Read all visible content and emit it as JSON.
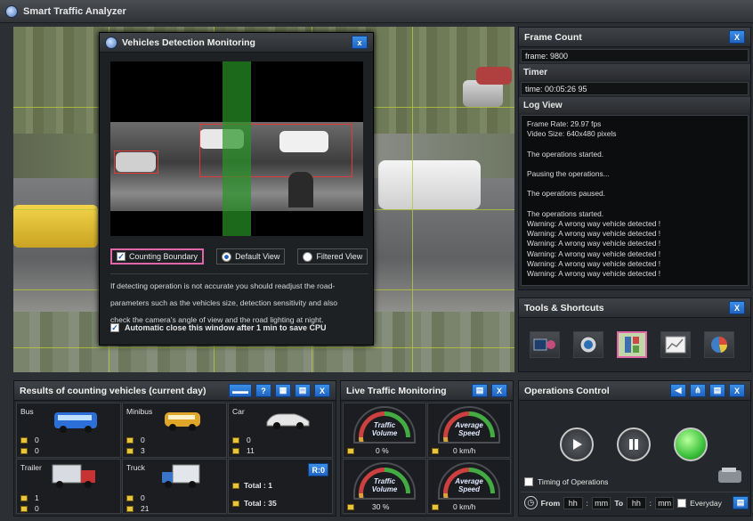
{
  "app": {
    "title": "Smart Traffic Analyzer"
  },
  "dialog": {
    "title": "Vehicles Detection Monitoring",
    "close_label": "x",
    "counting_boundary": "Counting Boundary",
    "default_view": "Default View",
    "filtered_view": "Filtered View",
    "hint_line1": "If detecting operation is not accurate you should readjust the road-",
    "hint_line2": "parameters such as the vehicles size, detection sensitivity and also",
    "hint_line3": "check  the camera's angle of view  and  the road lighting at night.",
    "auto_close": "Automatic close this window after  1 min  to save  CPU"
  },
  "frame_count": {
    "title": "Frame Count",
    "close_label": "X",
    "value": "frame: 9800"
  },
  "timer": {
    "title": "Timer",
    "value": "time: 00:05:26 95"
  },
  "log_view": {
    "title": "Log View",
    "lines": [
      "Frame Rate: 29.97 fps",
      "Video Size: 640x480 pixels",
      "",
      "The operations started.",
      "",
      "Pausing the operations...",
      "",
      "The operations paused.",
      "",
      "The operations started.",
      "Warning: A wrong way vehicle detected !",
      "Warning: A wrong way vehicle detected !",
      "Warning: A wrong way vehicle detected !",
      "Warning: A wrong way vehicle detected !",
      "Warning: A wrong way vehicle detected !",
      "Warning: A wrong way vehicle detected !"
    ]
  },
  "tools": {
    "title": "Tools & Shortcuts",
    "close_label": "X"
  },
  "counting": {
    "title": "Results of counting vehicles  (current day)",
    "help_label": "?",
    "close_label": "X",
    "reset_label": "R:0",
    "bus": {
      "label": "Bus",
      "a": "0",
      "b": "0"
    },
    "minibus": {
      "label": "Minibus",
      "a": "0",
      "b": "3"
    },
    "car": {
      "label": "Car",
      "a": "0",
      "b": "11"
    },
    "trailer": {
      "label": "Trailer",
      "a": "1",
      "b": "0"
    },
    "truck": {
      "label": "Truck",
      "a": "0",
      "b": "21"
    },
    "total1": "Total : 1",
    "total2": "Total : 35"
  },
  "live": {
    "title": "Live Traffic Monitoring",
    "close_label": "X",
    "gauges": [
      {
        "line1": "Traffic",
        "line2": "Volume",
        "value": "0 %"
      },
      {
        "line1": "Average",
        "line2": "Speed",
        "value": "0 km/h"
      },
      {
        "line1": "Traffic",
        "line2": "Volume",
        "value": "30 %"
      },
      {
        "line1": "Average",
        "line2": "Speed",
        "value": "0 km/h"
      }
    ]
  },
  "ops": {
    "title": "Operations Control",
    "close_label": "X",
    "timing_label": "Timing of Operations",
    "from_label": "From",
    "to_label": "To",
    "hh": "hh",
    "mm": "mm",
    "everyday": "Everyday"
  },
  "colors": {
    "accent": "#1f63c2",
    "highlight": "#e066a8",
    "go_green": "#3cc23c"
  }
}
